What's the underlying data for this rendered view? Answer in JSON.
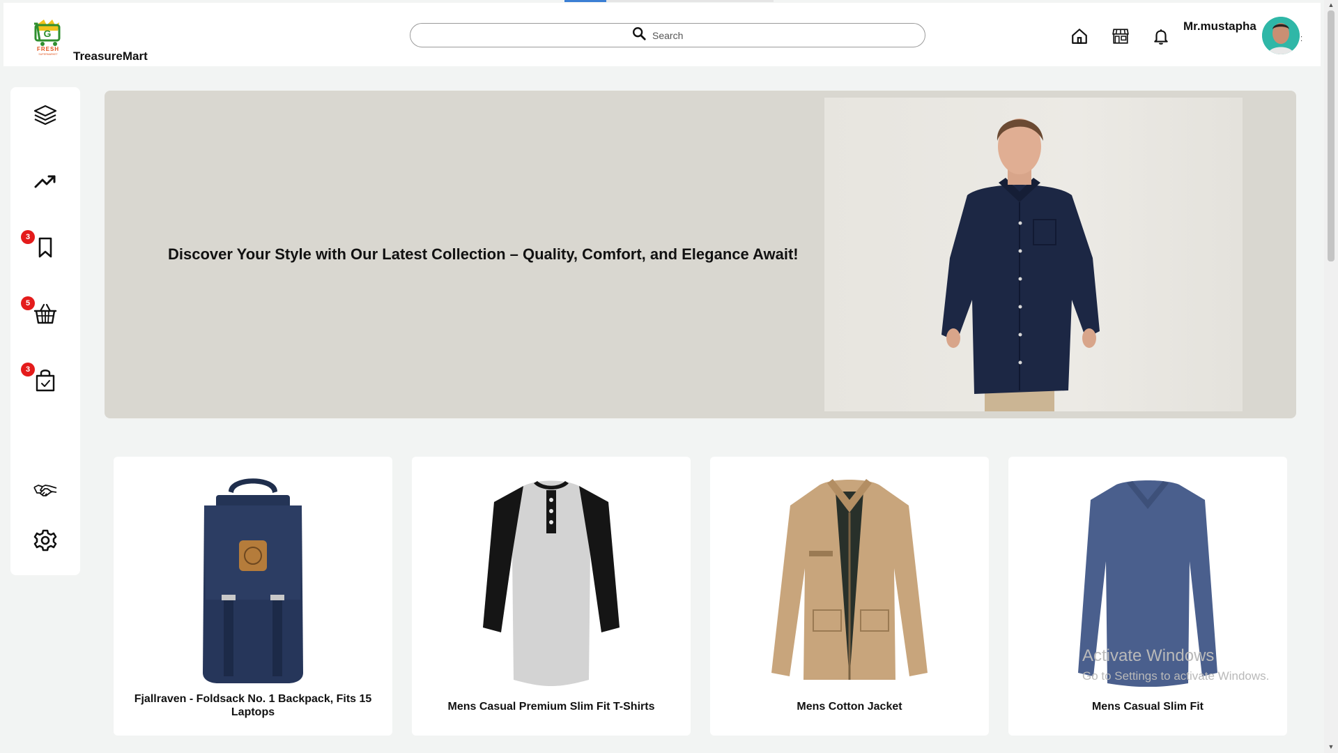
{
  "header": {
    "brand": "TreasureMart",
    "logo_text": "FRESH",
    "logo_subtext": "SUPERMARKET",
    "search_placeholder": "Search",
    "username": "Mr.mustapha",
    "icons": [
      "home-icon",
      "store-icon",
      "bell-icon"
    ]
  },
  "sidebar": {
    "items": [
      {
        "icon": "layers-icon"
      },
      {
        "icon": "trending-up-icon"
      },
      {
        "icon": "bookmark-icon",
        "badge": "3"
      },
      {
        "icon": "basket-icon",
        "badge": "5"
      },
      {
        "icon": "shopping-bag-check-icon",
        "badge": "3"
      },
      {
        "icon": "handshake-icon"
      },
      {
        "icon": "settings-icon"
      }
    ]
  },
  "banner": {
    "headline": "Discover Your Style with Our Latest Collection – Quality, Comfort, and Elegance Await!"
  },
  "products": [
    {
      "title": "Fjallraven - Foldsack No. 1 Backpack, Fits 15 Laptops",
      "image": "navy-backpack"
    },
    {
      "title": "Mens Casual Premium Slim Fit T-Shirts",
      "image": "raglan-henley-tshirt"
    },
    {
      "title": "Mens Cotton Jacket",
      "image": "khaki-jacket"
    },
    {
      "title": "Mens Casual Slim Fit",
      "image": "blue-longsleeve-shirt"
    }
  ],
  "watermark": {
    "title": "Activate Windows",
    "subtitle": "Go to Settings to activate Windows."
  },
  "colors": {
    "page_bg": "#f2f4f3",
    "badge": "#e41b1b",
    "banner_bg": "#d9d7d0",
    "accent": "#3b7fd4"
  }
}
